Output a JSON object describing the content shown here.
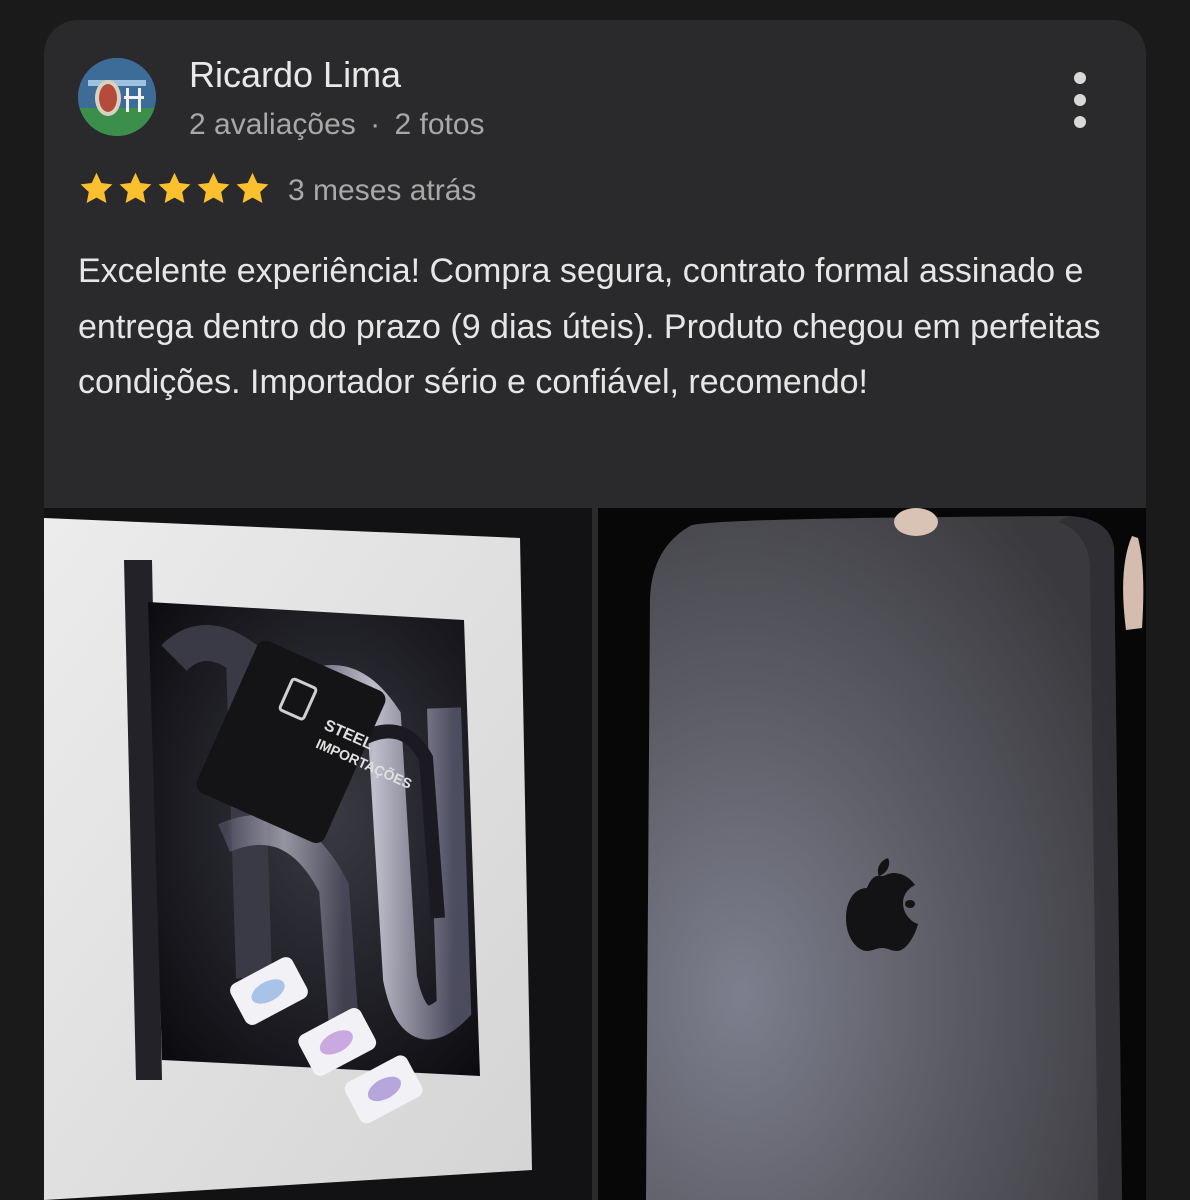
{
  "review": {
    "author": {
      "name": "Ricardo Lima",
      "reviews": "2 avaliações",
      "separator": "·",
      "photos": "2 fotos"
    },
    "rating": 5,
    "time_ago": "3 meses atrás",
    "text": "Excelente experiência! Compra segura, contrato formal assinado e entrega dentro do prazo (9 dias úteis). Produto chegou em perfeitas condições. Importador sério e confiável, recomendo!",
    "more_icon": "more-vert-icon",
    "star_icon": "star-icon",
    "colors": {
      "star": "#fbc02d",
      "background": "#2a2a2c",
      "page": "#1a1a1b"
    },
    "photos": [
      {
        "name": "photo-macbook-box",
        "card_text": [
          "STEEL",
          "IMPORTAÇÕES"
        ]
      },
      {
        "name": "photo-macbook-lid"
      }
    ]
  }
}
